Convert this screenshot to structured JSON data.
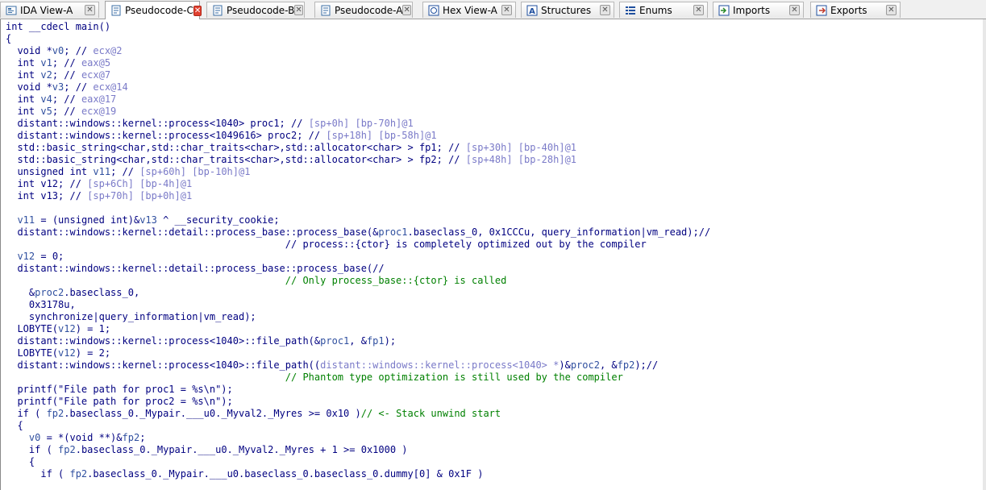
{
  "tabs": [
    {
      "label": "IDA View-A",
      "icon": "ida-view-icon",
      "active": false
    },
    {
      "label": "Pseudocode-C",
      "icon": "pseudocode-icon",
      "active": true
    },
    {
      "label": "Pseudocode-B",
      "icon": "pseudocode-icon",
      "active": false
    },
    {
      "label": "Pseudocode-A",
      "icon": "pseudocode-icon",
      "active": false
    },
    {
      "label": "Hex View-A",
      "icon": "hex-view-icon",
      "active": false
    },
    {
      "label": "Structures",
      "icon": "structures-icon",
      "active": false
    },
    {
      "label": "Enums",
      "icon": "enums-icon",
      "active": false
    },
    {
      "label": "Imports",
      "icon": "imports-icon",
      "active": false
    },
    {
      "label": "Exports",
      "icon": "exports-icon",
      "active": false
    }
  ],
  "close_glyph": "✕",
  "colors": {
    "keyword": "#000080",
    "variable": "#2f4f9f",
    "comment_addr": "#7a7ac8",
    "comment_text": "#008000",
    "active_close": "#e04030"
  },
  "code": [
    [
      [
        "k",
        "int __cdecl main()"
      ]
    ],
    [
      [
        "k",
        "{"
      ]
    ],
    [
      [
        "k",
        "  void *"
      ],
      [
        "v",
        "v0"
      ],
      [
        "k",
        "; // "
      ],
      [
        "c",
        "ecx@2"
      ]
    ],
    [
      [
        "k",
        "  int "
      ],
      [
        "v",
        "v1"
      ],
      [
        "k",
        "; // "
      ],
      [
        "c",
        "eax@5"
      ]
    ],
    [
      [
        "k",
        "  int "
      ],
      [
        "v",
        "v2"
      ],
      [
        "k",
        "; // "
      ],
      [
        "c",
        "ecx@7"
      ]
    ],
    [
      [
        "k",
        "  void *"
      ],
      [
        "v",
        "v3"
      ],
      [
        "k",
        "; // "
      ],
      [
        "c",
        "ecx@14"
      ]
    ],
    [
      [
        "k",
        "  int "
      ],
      [
        "v",
        "v4"
      ],
      [
        "k",
        "; // "
      ],
      [
        "c",
        "eax@17"
      ]
    ],
    [
      [
        "k",
        "  int "
      ],
      [
        "v",
        "v5"
      ],
      [
        "k",
        "; // "
      ],
      [
        "c",
        "ecx@19"
      ]
    ],
    [
      [
        "k",
        "  distant::windows::kernel::process<1040> proc1; // "
      ],
      [
        "c",
        "[sp+0h] [bp-70h]@1"
      ]
    ],
    [
      [
        "k",
        "  distant::windows::kernel::process<1049616> proc2; // "
      ],
      [
        "c",
        "[sp+18h] [bp-58h]@1"
      ]
    ],
    [
      [
        "k",
        "  std::basic_string<char,std::char_traits<char>,std::allocator<char> > fp1; // "
      ],
      [
        "c",
        "[sp+30h] [bp-40h]@1"
      ]
    ],
    [
      [
        "k",
        "  std::basic_string<char,std::char_traits<char>,std::allocator<char> > fp2; // "
      ],
      [
        "c",
        "[sp+48h] [bp-28h]@1"
      ]
    ],
    [
      [
        "k",
        "  unsigned int "
      ],
      [
        "v",
        "v11"
      ],
      [
        "k",
        "; // "
      ],
      [
        "c",
        "[sp+60h] [bp-10h]@1"
      ]
    ],
    [
      [
        "k",
        "  int v12; // "
      ],
      [
        "c",
        "[sp+6Ch] [bp-4h]@1"
      ]
    ],
    [
      [
        "k",
        "  int v13; // "
      ],
      [
        "c",
        "[sp+70h] [bp+0h]@1"
      ]
    ],
    [
      [
        "k",
        ""
      ]
    ],
    [
      [
        "k",
        "  "
      ],
      [
        "v",
        "v11"
      ],
      [
        "k",
        " = (unsigned int)&"
      ],
      [
        "v",
        "v13"
      ],
      [
        "k",
        " ^ __security_cookie;"
      ]
    ],
    [
      [
        "k",
        "  distant::windows::kernel::detail::process_base::process_base(&"
      ],
      [
        "v",
        "proc1"
      ],
      [
        "k",
        ".baseclass_0, 0x1CCCu, query_information|vm_read);//"
      ]
    ],
    [
      [
        "k",
        "                                                // process::{ctor} is completely optimized out by the compiler"
      ]
    ],
    [
      [
        "k",
        "  "
      ],
      [
        "v",
        "v12"
      ],
      [
        "k",
        " = 0;"
      ]
    ],
    [
      [
        "k",
        "  distant::windows::kernel::detail::process_base::process_base(//"
      ]
    ],
    [
      [
        "g",
        "                                                // Only process_base::{ctor} is called"
      ]
    ],
    [
      [
        "k",
        "    &"
      ],
      [
        "v",
        "proc2"
      ],
      [
        "k",
        ".baseclass_0,"
      ]
    ],
    [
      [
        "k",
        "    0x3178u,"
      ]
    ],
    [
      [
        "k",
        "    synchronize|query_information|vm_read);"
      ]
    ],
    [
      [
        "k",
        "  LOBYTE("
      ],
      [
        "v",
        "v12"
      ],
      [
        "k",
        ") = 1;"
      ]
    ],
    [
      [
        "k",
        "  distant::windows::kernel::process<1040>::file_path(&"
      ],
      [
        "v",
        "proc1"
      ],
      [
        "k",
        ", &"
      ],
      [
        "v",
        "fp1"
      ],
      [
        "k",
        ");"
      ]
    ],
    [
      [
        "k",
        "  LOBYTE("
      ],
      [
        "v",
        "v12"
      ],
      [
        "k",
        ") = 2;"
      ]
    ],
    [
      [
        "k",
        "  distant::windows::kernel::process<1040>::file_path(("
      ],
      [
        "c",
        "distant::windows::kernel::process<1040> *"
      ],
      [
        "k",
        ")&"
      ],
      [
        "v",
        "proc2"
      ],
      [
        "k",
        ", &"
      ],
      [
        "v",
        "fp2"
      ],
      [
        "k",
        ");//"
      ]
    ],
    [
      [
        "g",
        "                                                // Phantom type optimization is still used by the compiler"
      ]
    ],
    [
      [
        "k",
        "  printf(\"File path for proc1 = %s\\n\");"
      ]
    ],
    [
      [
        "k",
        "  printf(\"File path for proc2 = %s\\n\");"
      ]
    ],
    [
      [
        "k",
        "  if ( "
      ],
      [
        "v",
        "fp2"
      ],
      [
        "k",
        ".baseclass_0._Mypair.___u0._Myval2._Myres >= 0x10 )"
      ],
      [
        "g",
        "// <- Stack unwind start"
      ]
    ],
    [
      [
        "k",
        "  {"
      ]
    ],
    [
      [
        "k",
        "    "
      ],
      [
        "v",
        "v0"
      ],
      [
        "k",
        " = *(void **)&"
      ],
      [
        "v",
        "fp2"
      ],
      [
        "k",
        ";"
      ]
    ],
    [
      [
        "k",
        "    if ( "
      ],
      [
        "v",
        "fp2"
      ],
      [
        "k",
        ".baseclass_0._Mypair.___u0._Myval2._Myres + 1 >= 0x1000 )"
      ]
    ],
    [
      [
        "k",
        "    {"
      ]
    ],
    [
      [
        "k",
        "      if ( "
      ],
      [
        "v",
        "fp2"
      ],
      [
        "k",
        ".baseclass_0._Mypair.___u0.baseclass_0.baseclass_0.dummy[0] & 0x1F )"
      ]
    ]
  ]
}
